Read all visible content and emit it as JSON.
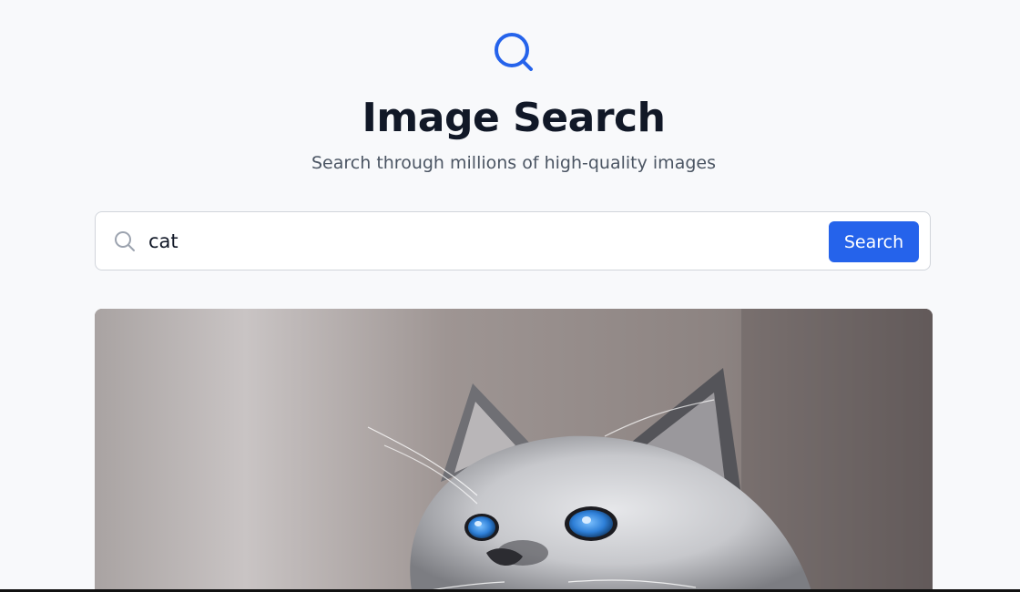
{
  "header": {
    "logo_icon": "search-icon",
    "title": "Image Search",
    "subtitle": "Search through millions of high-quality images"
  },
  "search": {
    "icon": "search-icon",
    "value": "cat",
    "button_label": "Search"
  },
  "results": [
    {
      "subject": "cat"
    }
  ],
  "colors": {
    "accent": "#2563eb",
    "background": "#f8f9fb",
    "title": "#111827",
    "subtitle": "#4b5563"
  }
}
